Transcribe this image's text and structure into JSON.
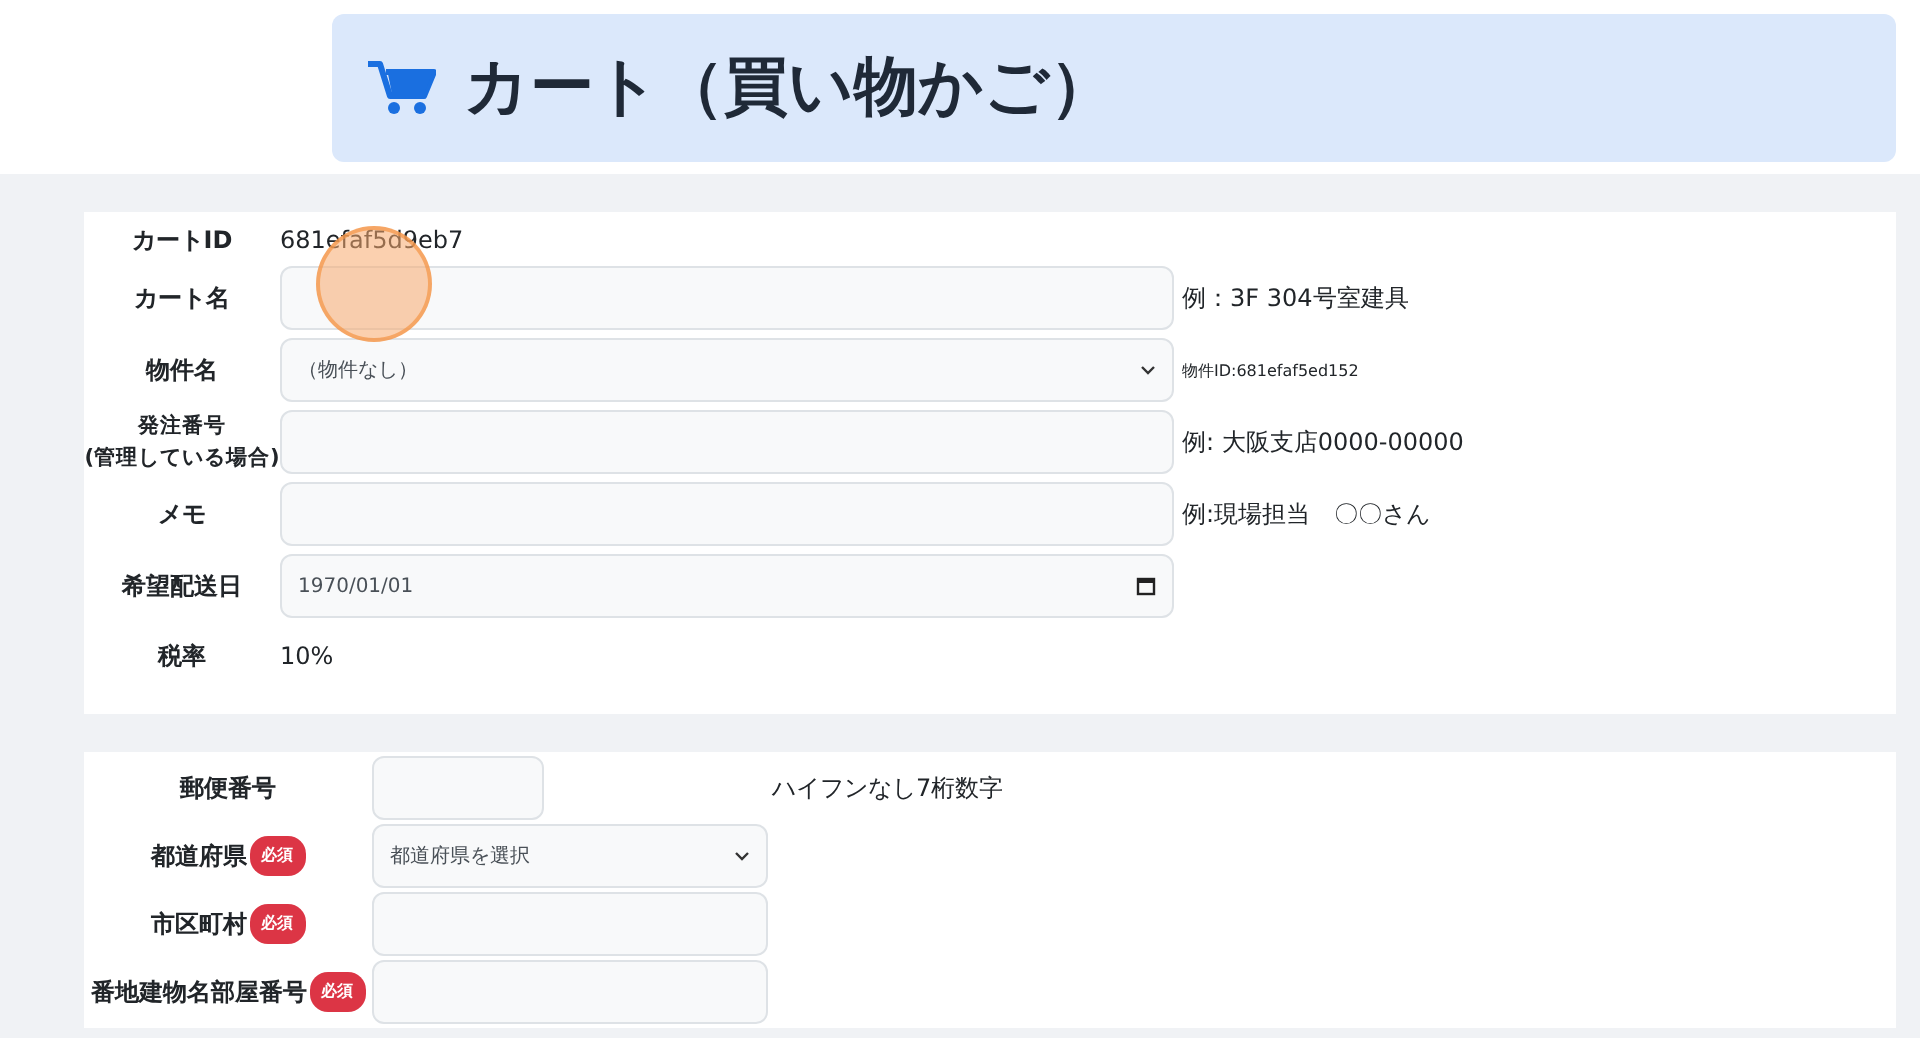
{
  "header": {
    "title": "カート（買い物かご）"
  },
  "cart_form": {
    "rows": [
      {
        "label": "カートID",
        "kind": "text",
        "value": "681efaf5d9eb7"
      },
      {
        "label": "カート名",
        "kind": "input",
        "hint": "例：3F 304号室建具"
      },
      {
        "label": "物件名",
        "kind": "select",
        "value": "（物件なし）",
        "hint": "物件ID:681efaf5ed152",
        "hint_small": true
      },
      {
        "label": "発注番号\n(管理している場合)",
        "kind": "input",
        "hint": "例: 大阪支店0000-00000"
      },
      {
        "label": "メモ",
        "kind": "input",
        "hint": "例:現場担当　〇〇さん"
      },
      {
        "label": "希望配送日",
        "kind": "date",
        "value": "1970/01/01"
      },
      {
        "label": "税率",
        "kind": "text",
        "value": "10%"
      }
    ]
  },
  "address_form": {
    "rows": [
      {
        "label": "郵便番号",
        "kind": "short",
        "required": false,
        "hint": "ハイフンなし7桁数字"
      },
      {
        "label": "都道府県",
        "kind": "select",
        "required": true,
        "badge": "必須",
        "placeholder": "都道府県を選択"
      },
      {
        "label": "市区町村",
        "kind": "input",
        "required": true,
        "badge": "必須"
      },
      {
        "label": "番地建物名部屋番号",
        "kind": "input",
        "required": true,
        "badge": "必須"
      }
    ]
  }
}
